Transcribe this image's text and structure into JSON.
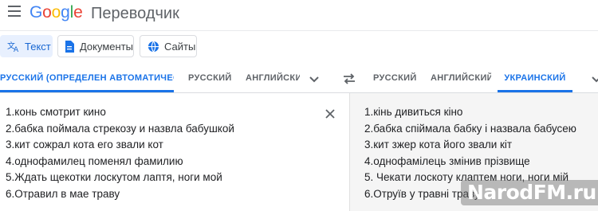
{
  "header": {
    "logo": {
      "g1": "G",
      "o1": "o",
      "o2": "o",
      "g2": "g",
      "l": "l",
      "e": "e"
    },
    "product_name": "Переводчик",
    "menu_icon": "hamburger-menu-icon"
  },
  "modes": [
    {
      "label": "Текст",
      "icon": "translate-icon",
      "active": true
    },
    {
      "label": "Документы",
      "icon": "document-icon",
      "active": false
    },
    {
      "label": "Сайты",
      "icon": "globe-icon",
      "active": false
    }
  ],
  "source_langs": {
    "detected": "РУССКИЙ (ОПРЕДЕЛЕН АВТОМАТИЧЕСКИ)",
    "lang1": "РУССКИЙ",
    "lang2": "АНГЛИЙСКИЙ"
  },
  "target_langs": {
    "lang1": "РУССКИЙ",
    "lang2": "АНГЛИЙСКИЙ",
    "lang3": "УКРАИНСКИЙ"
  },
  "source_text": [
    "1.конь смотрит кино",
    "2.бабка поймала стрекозу и назвла бабушкой",
    "3.кит сожрал кота его звали кот",
    "4.однофамилец поменял фамилию",
    "5.Ждать щекотки лоскутом лаптя, ноги мой",
    "6.Отравил в мае траву"
  ],
  "target_text": [
    "1.кінь дивиться кіно",
    "2.бабка спіймала бабку і назвала бабусею",
    "3.кит зжер кота його звали кіт",
    "4.однофамілець змінив прізвище",
    "5. Чекати лоскоту клаптем ноги, ноги мій",
    "6.Отруїв у травні траву"
  ],
  "watermark": "NarodFM.ru",
  "colors": {
    "accent": "#1a73e8",
    "active_mode_bg": "#e8f0fe",
    "target_bg": "#f5f5f5"
  }
}
